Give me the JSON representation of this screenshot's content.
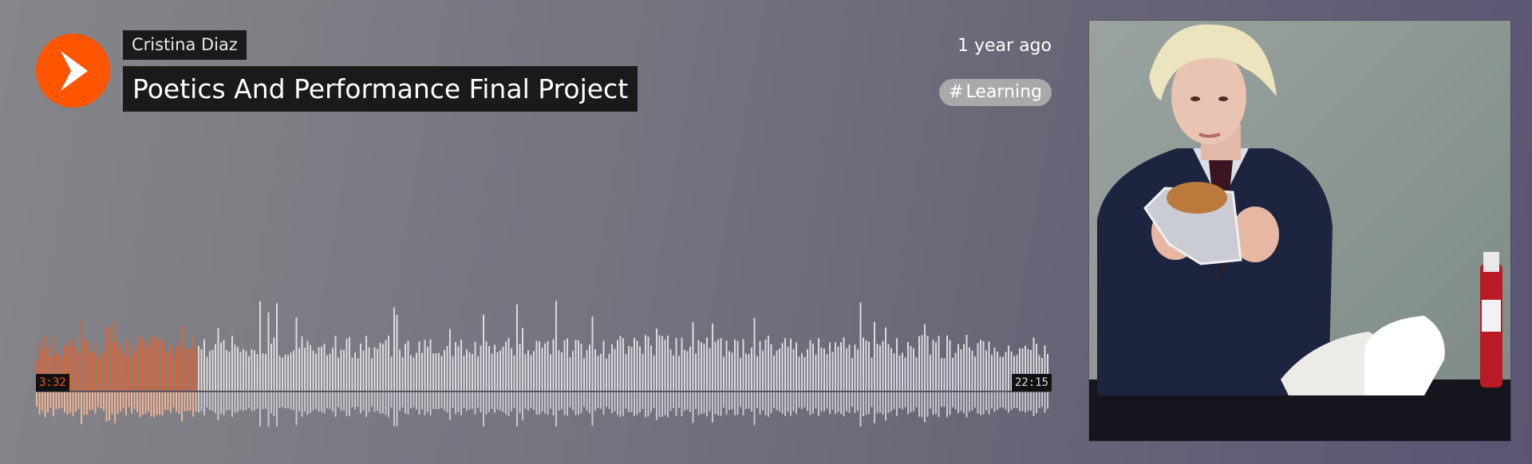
{
  "track": {
    "artist": "Cristina Diaz",
    "title": "Poetics And Performance Final Project",
    "uploaded": "1 year ago",
    "tag": "Learning",
    "tag_prefix": "#"
  },
  "player": {
    "current_time": "3:32",
    "duration": "22:15",
    "progress": 0.159
  },
  "icons": {
    "play": "play-icon"
  },
  "colors": {
    "accent": "#ff5500",
    "played_bar": "#e0622f",
    "unplayed_bar": "#dcdadf",
    "label_bg": "#1a1a1a"
  }
}
